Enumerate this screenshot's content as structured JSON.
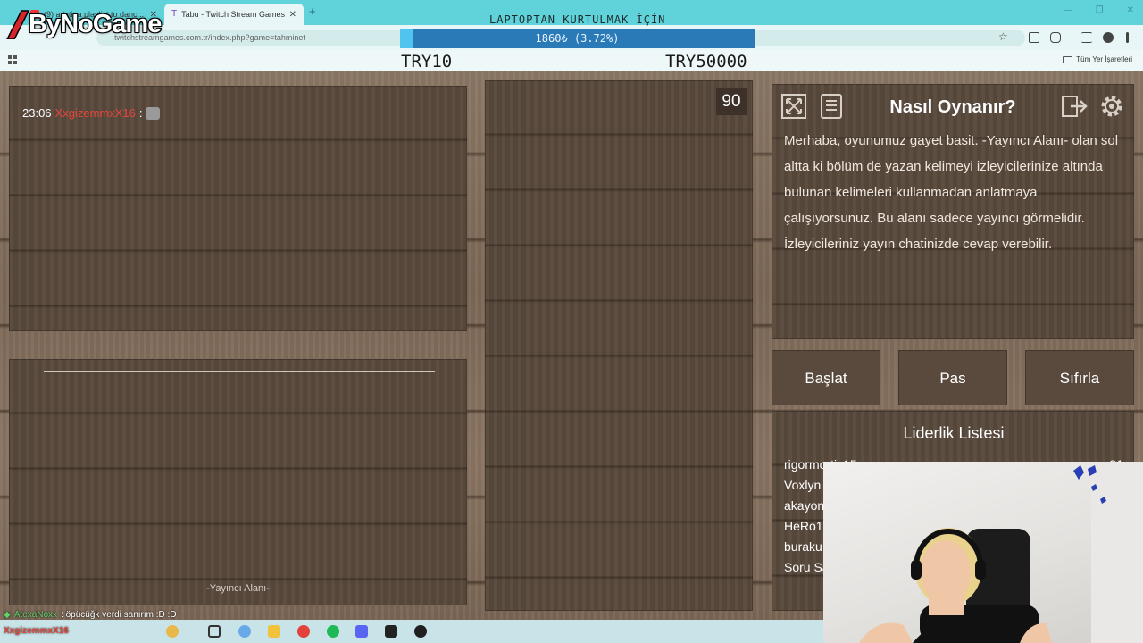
{
  "browser": {
    "tabs": [
      {
        "label": "(9) a latina playlist to danc...",
        "active": false
      },
      {
        "label": "Tabu - Twitch Stream Games",
        "active": true
      }
    ],
    "new_tab_label": "+",
    "url": "twitchstreamgames.com.tr/index.php?game=tahminet",
    "bookmarks_label": "Tüm Yer İşaretleri"
  },
  "overlay": {
    "title": "LAPTOPTAN KURTULMAK İÇİN",
    "goal_text": "1860₺ (3.72%)",
    "goal_percent": 3.72,
    "goal_min": "TRY10",
    "goal_max": "TRY50000",
    "logo_text": "ByNoGame"
  },
  "game": {
    "chat": {
      "time": "23:06",
      "user": "XxgizemmxX16",
      "separator": ":"
    },
    "streamer_label": "-Yayıncı Alanı-",
    "timer": "90",
    "info": {
      "title": "Nasıl Oynanır?",
      "text": "Merhaba, oyunumuz gayet basit. -Yayıncı Alanı- olan sol altta ki bölüm de yazan kelimeyi izleyicilerinize altında bulunan kelimeleri kullanmadan anlatmaya çalışıyorsunuz. Bu alanı sadece yayıncı görmelidir. İzleyicileriniz yayın chatinizde cevap verebilir."
    },
    "buttons": {
      "start": "Başlat",
      "pass": "Pas",
      "reset": "Sıfırla"
    },
    "leaderboard": {
      "title": "Liderlik Listesi",
      "rows": [
        {
          "name": "rigormortis15",
          "score": "31"
        },
        {
          "name": "Voxlyn",
          "score": ""
        },
        {
          "name": "akayon",
          "score": ""
        },
        {
          "name": "HeRo1",
          "score": ""
        },
        {
          "name": "buraku",
          "score": ""
        },
        {
          "name": "Soru Sa",
          "score": ""
        }
      ]
    }
  },
  "stream": {
    "sub_alert": {
      "name": "AtexaNoxx",
      "message": ": öpücüğk verdi sanırım :D :D"
    },
    "taskbar_user": "XxgizemmxX16"
  },
  "colors": {
    "tabbar": "#5fd3d9",
    "goal_bar": "#2a7ab8",
    "goal_fill": "#4ec4ef",
    "wood": "#5a4a3d",
    "chat_user": "#e6453a"
  }
}
